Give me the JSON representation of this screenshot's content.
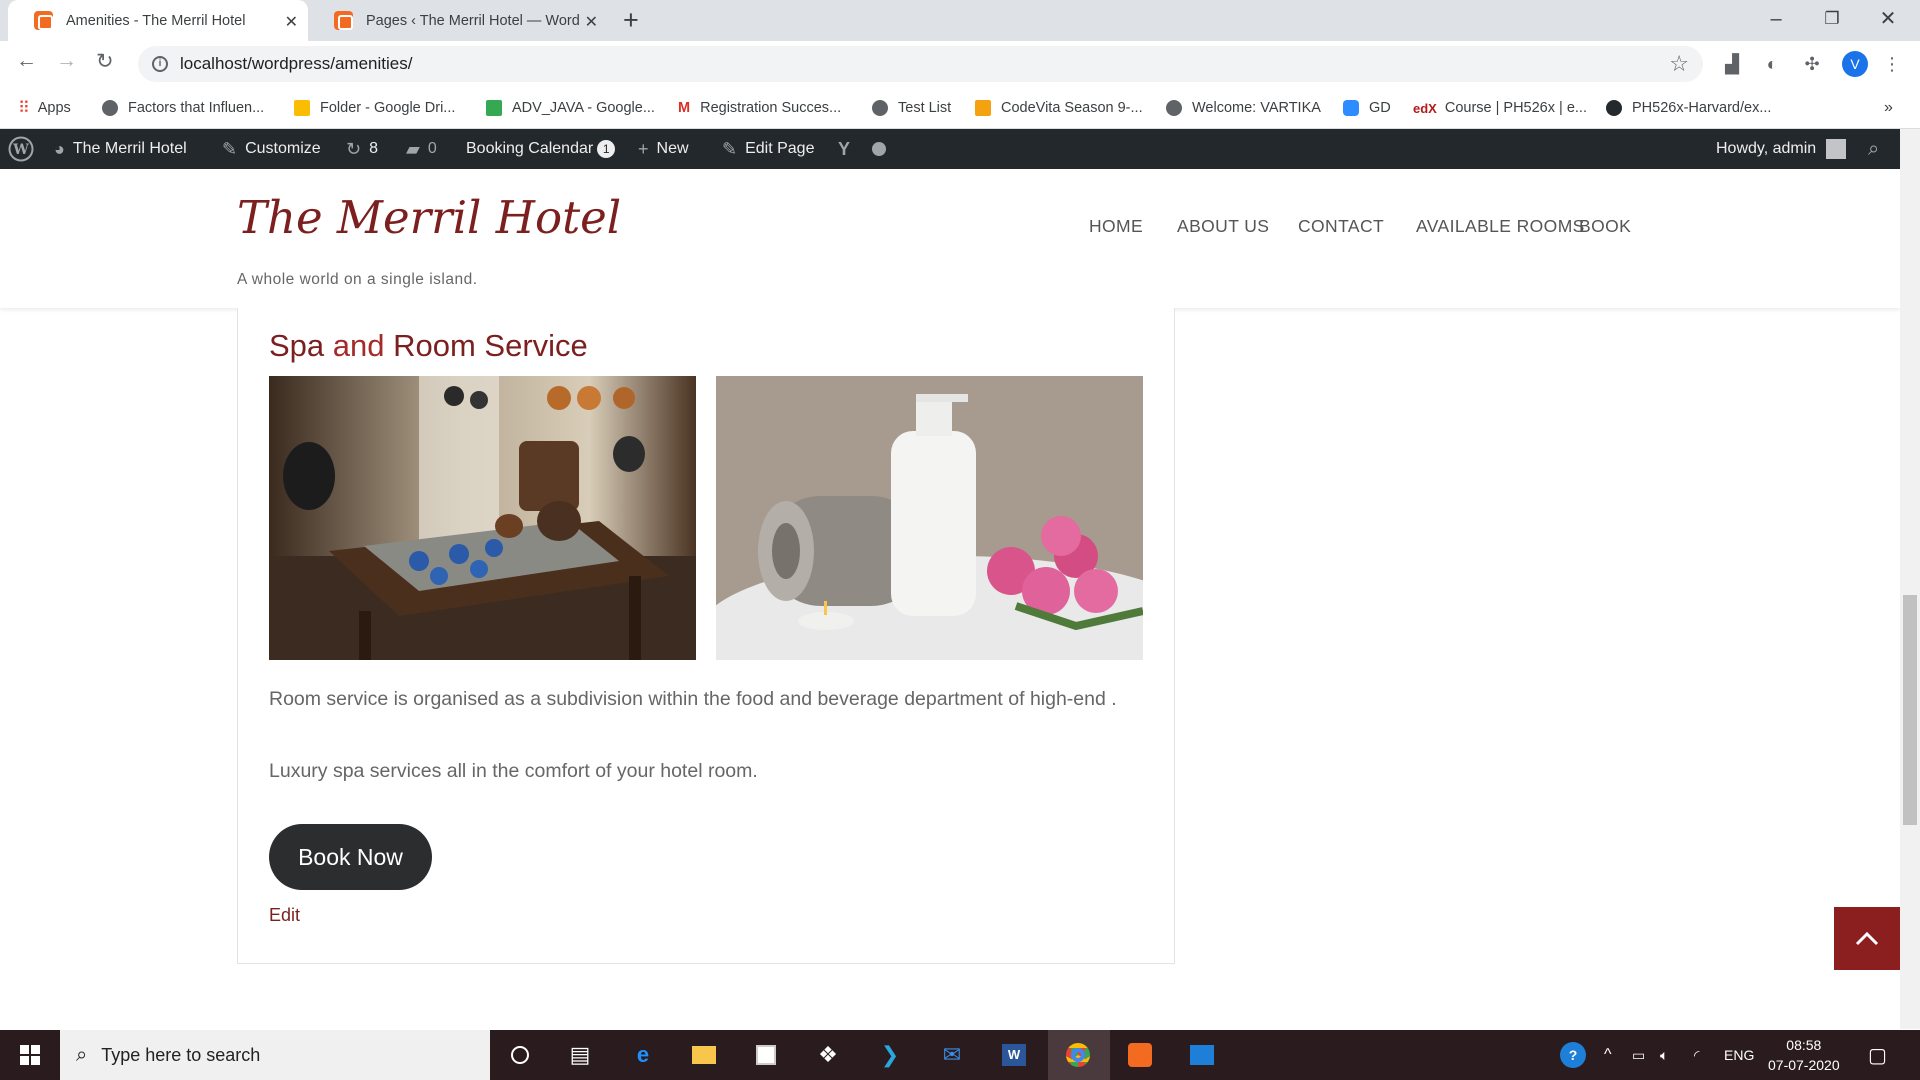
{
  "browser": {
    "tabs": [
      {
        "title": "Amenities - The Merril Hotel",
        "active": true
      },
      {
        "title": "Pages ‹ The Merril Hotel — Word",
        "active": false
      }
    ],
    "url": "localhost/wordpress/amenities/",
    "profile_initial": "V"
  },
  "bookmarks": [
    {
      "label": "Apps",
      "color": "#ea4335"
    },
    {
      "label": "Factors that Influen...",
      "color": "#5f6368"
    },
    {
      "label": "Folder - Google Dri...",
      "color": "#fbbc04"
    },
    {
      "label": "ADV_JAVA - Google...",
      "color": "#34a853"
    },
    {
      "label": "Registration Succes...",
      "color": "#d93025"
    },
    {
      "label": "Test List",
      "color": "#5f6368"
    },
    {
      "label": "CodeVita Season 9-...",
      "color": "#f4a20f"
    },
    {
      "label": "Welcome: VARTIKA",
      "color": "#5f6368"
    },
    {
      "label": "GD",
      "color": "#2d8cff"
    },
    {
      "label": "Course | PH526x | e...",
      "color": "#b31b1b"
    },
    {
      "label": "PH526x-Harvard/ex...",
      "color": "#24292e"
    }
  ],
  "wp_admin": {
    "site_name": "The Merril Hotel",
    "customize": "Customize",
    "updates": "8",
    "comments": "0",
    "booking_calendar": "Booking Calendar",
    "booking_badge": "1",
    "new": "New",
    "edit_page": "Edit Page",
    "howdy": "Howdy, admin"
  },
  "site": {
    "title": "The Merril Hotel",
    "tagline": "A whole world on a single island.",
    "menu": [
      "HOME",
      "ABOUT US",
      "CONTACT",
      "AVAILABLE ROOMS",
      "BOOK"
    ]
  },
  "content": {
    "heading_part1": "Spa ",
    "heading_part2": "and",
    "heading_part3": " Room Service",
    "para1": "Room service is organised as a subdivision within the food and beverage department of high-end .",
    "para2": "Luxury spa services all in the comfort of your hotel room.",
    "button": "Book Now",
    "edit": "Edit"
  },
  "taskbar": {
    "search_placeholder": "Type here to search",
    "lang": "ENG",
    "time": "08:58",
    "date": "07-07-2020"
  },
  "colors": {
    "brand": "#7b1f1f",
    "admin_bar": "#23282d",
    "button": "#2b2d2f",
    "back_to_top": "#8b1e1e"
  }
}
